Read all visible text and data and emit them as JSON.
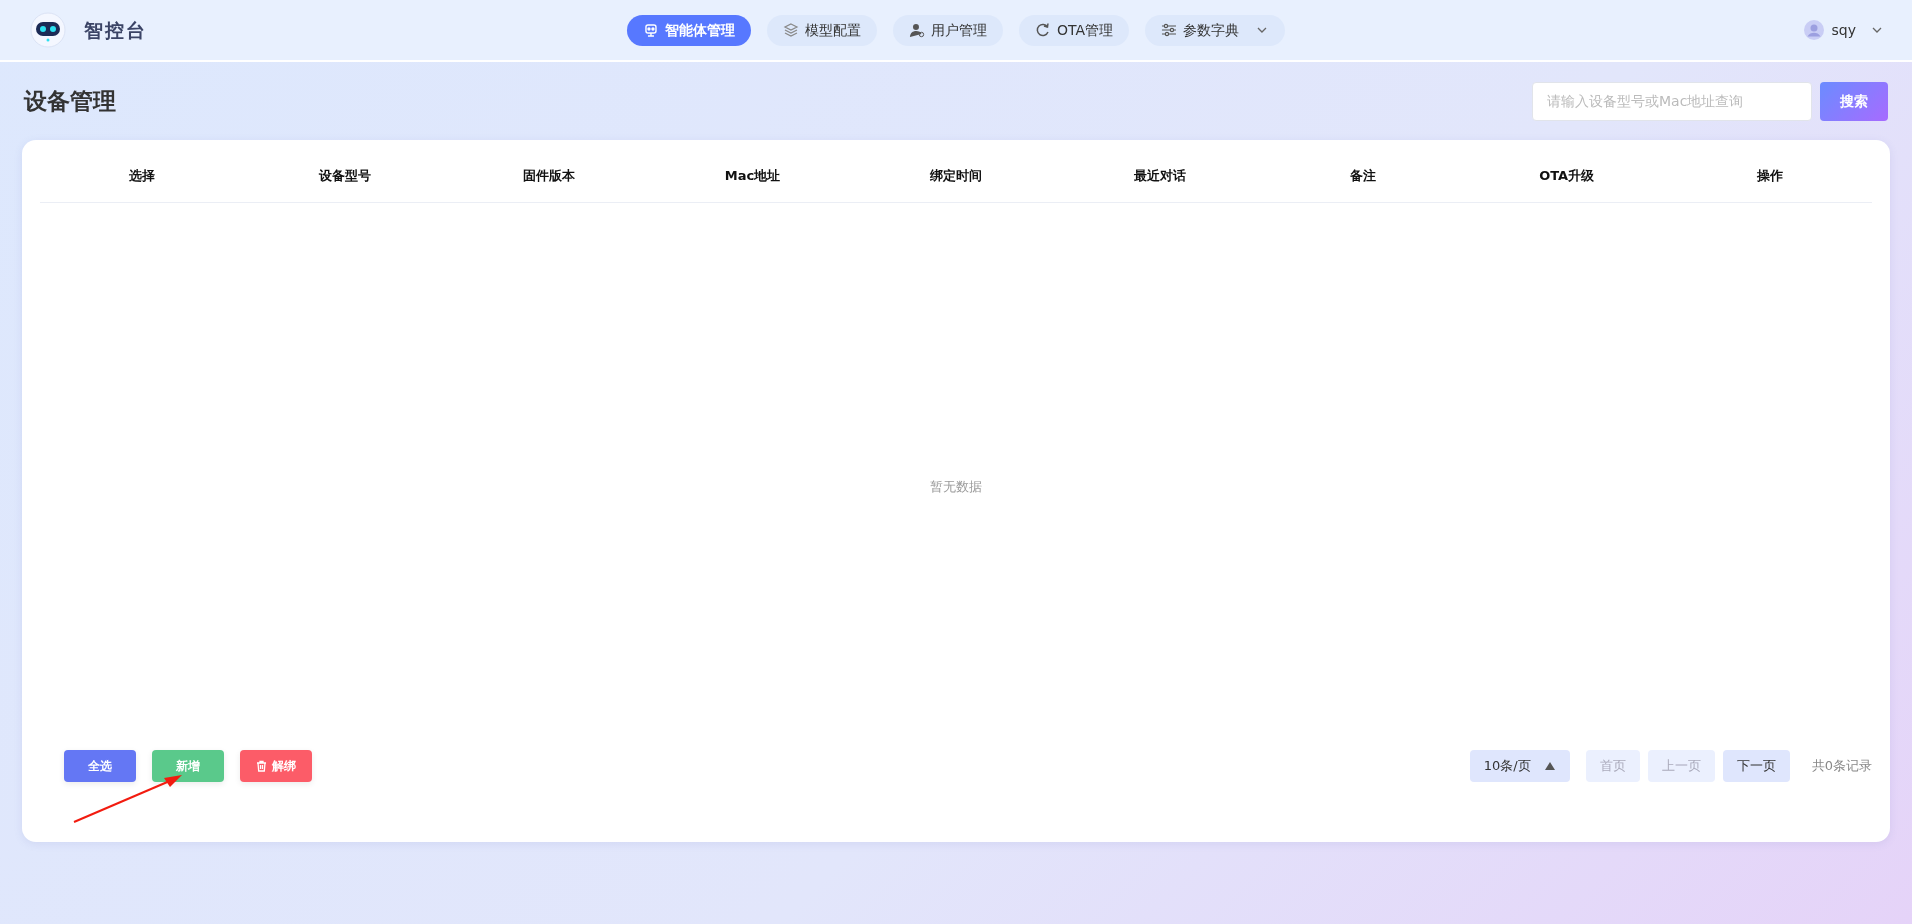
{
  "header": {
    "brand": "智控台",
    "nav": [
      {
        "label": "智能体管理",
        "kind": "robot",
        "selected": true
      },
      {
        "label": "模型配置",
        "kind": "layers",
        "selected": false
      },
      {
        "label": "用户管理",
        "kind": "user",
        "selected": false
      },
      {
        "label": "OTA管理",
        "kind": "refresh",
        "selected": false
      },
      {
        "label": "参数字典",
        "kind": "sliders",
        "selected": false,
        "dropdown": true
      }
    ],
    "user": {
      "name": "sqy"
    }
  },
  "page_title": "设备管理",
  "search": {
    "placeholder": "请输入设备型号或Mac地址查询",
    "button": "搜索"
  },
  "table": {
    "columns": [
      "选择",
      "设备型号",
      "固件版本",
      "Mac地址",
      "绑定时间",
      "最近对话",
      "备注",
      "OTA升级",
      "操作"
    ],
    "empty_text": "暂无数据"
  },
  "actions": [
    {
      "label": "全选",
      "kind": "primary"
    },
    {
      "label": "新增",
      "kind": "success"
    },
    {
      "label": "解绑",
      "kind": "danger"
    }
  ],
  "pagination": {
    "page_size": "10条/页",
    "buttons": [
      {
        "label": "首页",
        "disabled": true
      },
      {
        "label": "上一页",
        "disabled": true
      },
      {
        "label": "下一页",
        "disabled": false
      }
    ],
    "total": "共0条记录"
  },
  "annotation": {
    "kind": "arrow"
  }
}
